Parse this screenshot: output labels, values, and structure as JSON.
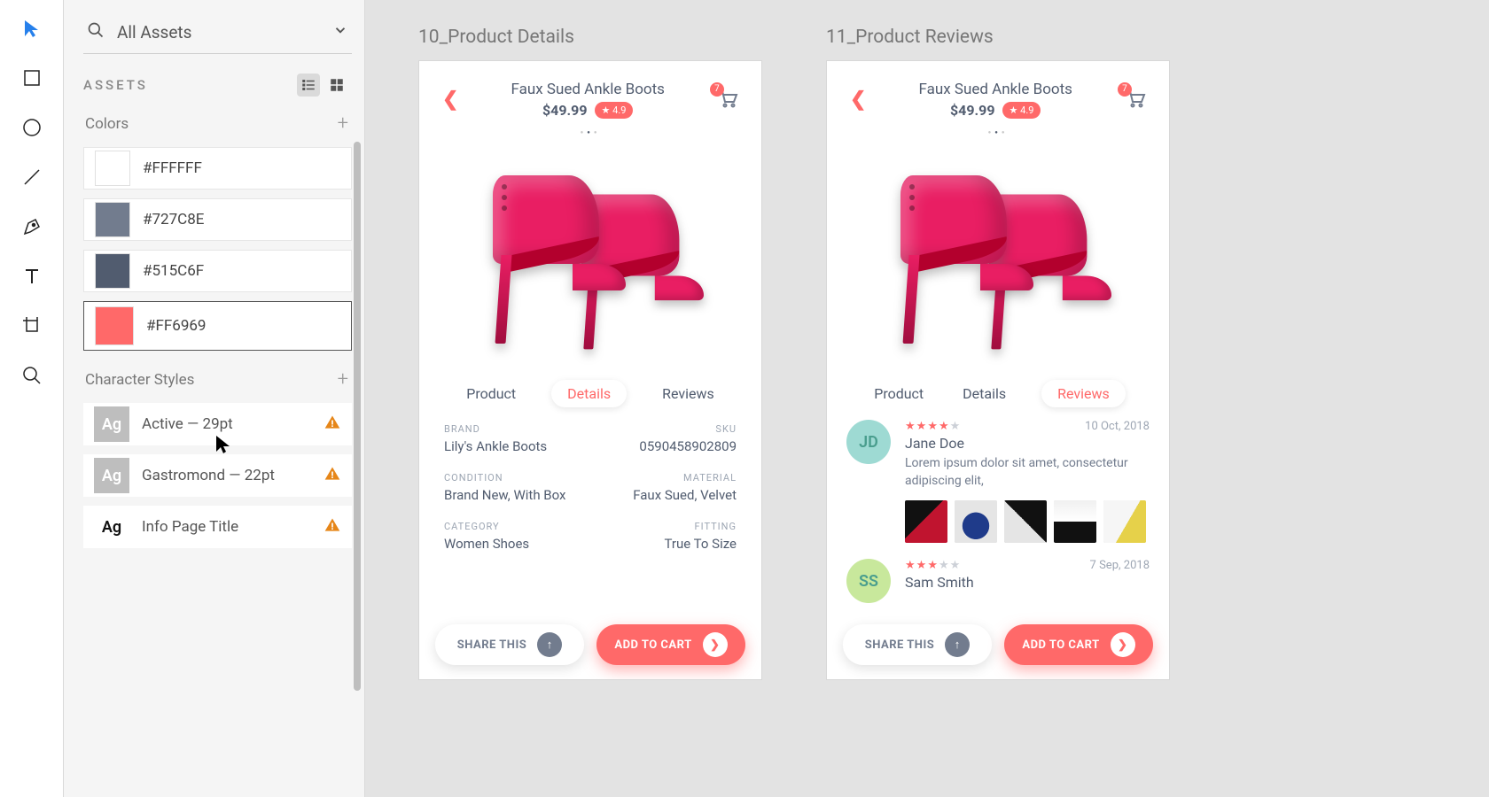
{
  "toolstrip": {
    "tools": [
      "select",
      "rectangle",
      "ellipse",
      "line",
      "pen",
      "text",
      "artboard",
      "zoom"
    ]
  },
  "panel": {
    "searchLabel": "All Assets",
    "heading": "ASSETS",
    "sections": {
      "colors": {
        "title": "Colors",
        "items": [
          {
            "hex": "#FFFFFF",
            "label": "#FFFFFF"
          },
          {
            "hex": "#727C8E",
            "label": "#727C8E"
          },
          {
            "hex": "#515C6F",
            "label": "#515C6F"
          },
          {
            "hex": "#FF6969",
            "label": "#FF6969",
            "hover": true
          }
        ]
      },
      "charstyles": {
        "title": "Character Styles",
        "items": [
          {
            "label": "Active — 29pt",
            "warn": true,
            "ghost": true
          },
          {
            "label": "Gastromond — 22pt",
            "warn": true,
            "ghost": true
          },
          {
            "label": "Info Page Title",
            "warn": true,
            "ghost": false
          }
        ]
      }
    }
  },
  "artboards": [
    {
      "name": "10_Product Details",
      "title": "Faux Sued Ankle Boots",
      "price": "$49.99",
      "rating": "4.9",
      "cartBadge": "7",
      "tabs": [
        "Product",
        "Details",
        "Reviews"
      ],
      "activeTab": "Details",
      "details": [
        {
          "l": "BRAND",
          "v": "Lily's Ankle Boots",
          "r": "SKU",
          "rv": "0590458902809"
        },
        {
          "l": "CONDITION",
          "v": "Brand New, With Box",
          "r": "MATERIAL",
          "rv": "Faux Sued, Velvet"
        },
        {
          "l": "CATEGORY",
          "v": "Women Shoes",
          "r": "FITTING",
          "rv": "True To Size"
        }
      ],
      "share": "SHARE THIS",
      "add": "ADD TO CART"
    },
    {
      "name": "11_Product Reviews",
      "title": "Faux Sued Ankle Boots",
      "price": "$49.99",
      "rating": "4.9",
      "cartBadge": "7",
      "tabs": [
        "Product",
        "Details",
        "Reviews"
      ],
      "activeTab": "Reviews",
      "reviews": [
        {
          "initials": "JD",
          "avatarBg": "#9EDAD3",
          "name": "Jane Doe",
          "date": "10 Oct, 2018",
          "stars": 4,
          "text": "Lorem ipsum dolor sit amet, consectetur adipiscing elit,",
          "thumbs": 5
        },
        {
          "initials": "SS",
          "avatarBg": "#C8E89C",
          "name": "Sam Smith",
          "date": "7 Sep, 2018",
          "stars": 3,
          "text": "",
          "thumbs": 0
        }
      ],
      "share": "SHARE THIS",
      "add": "ADD TO CART"
    }
  ]
}
